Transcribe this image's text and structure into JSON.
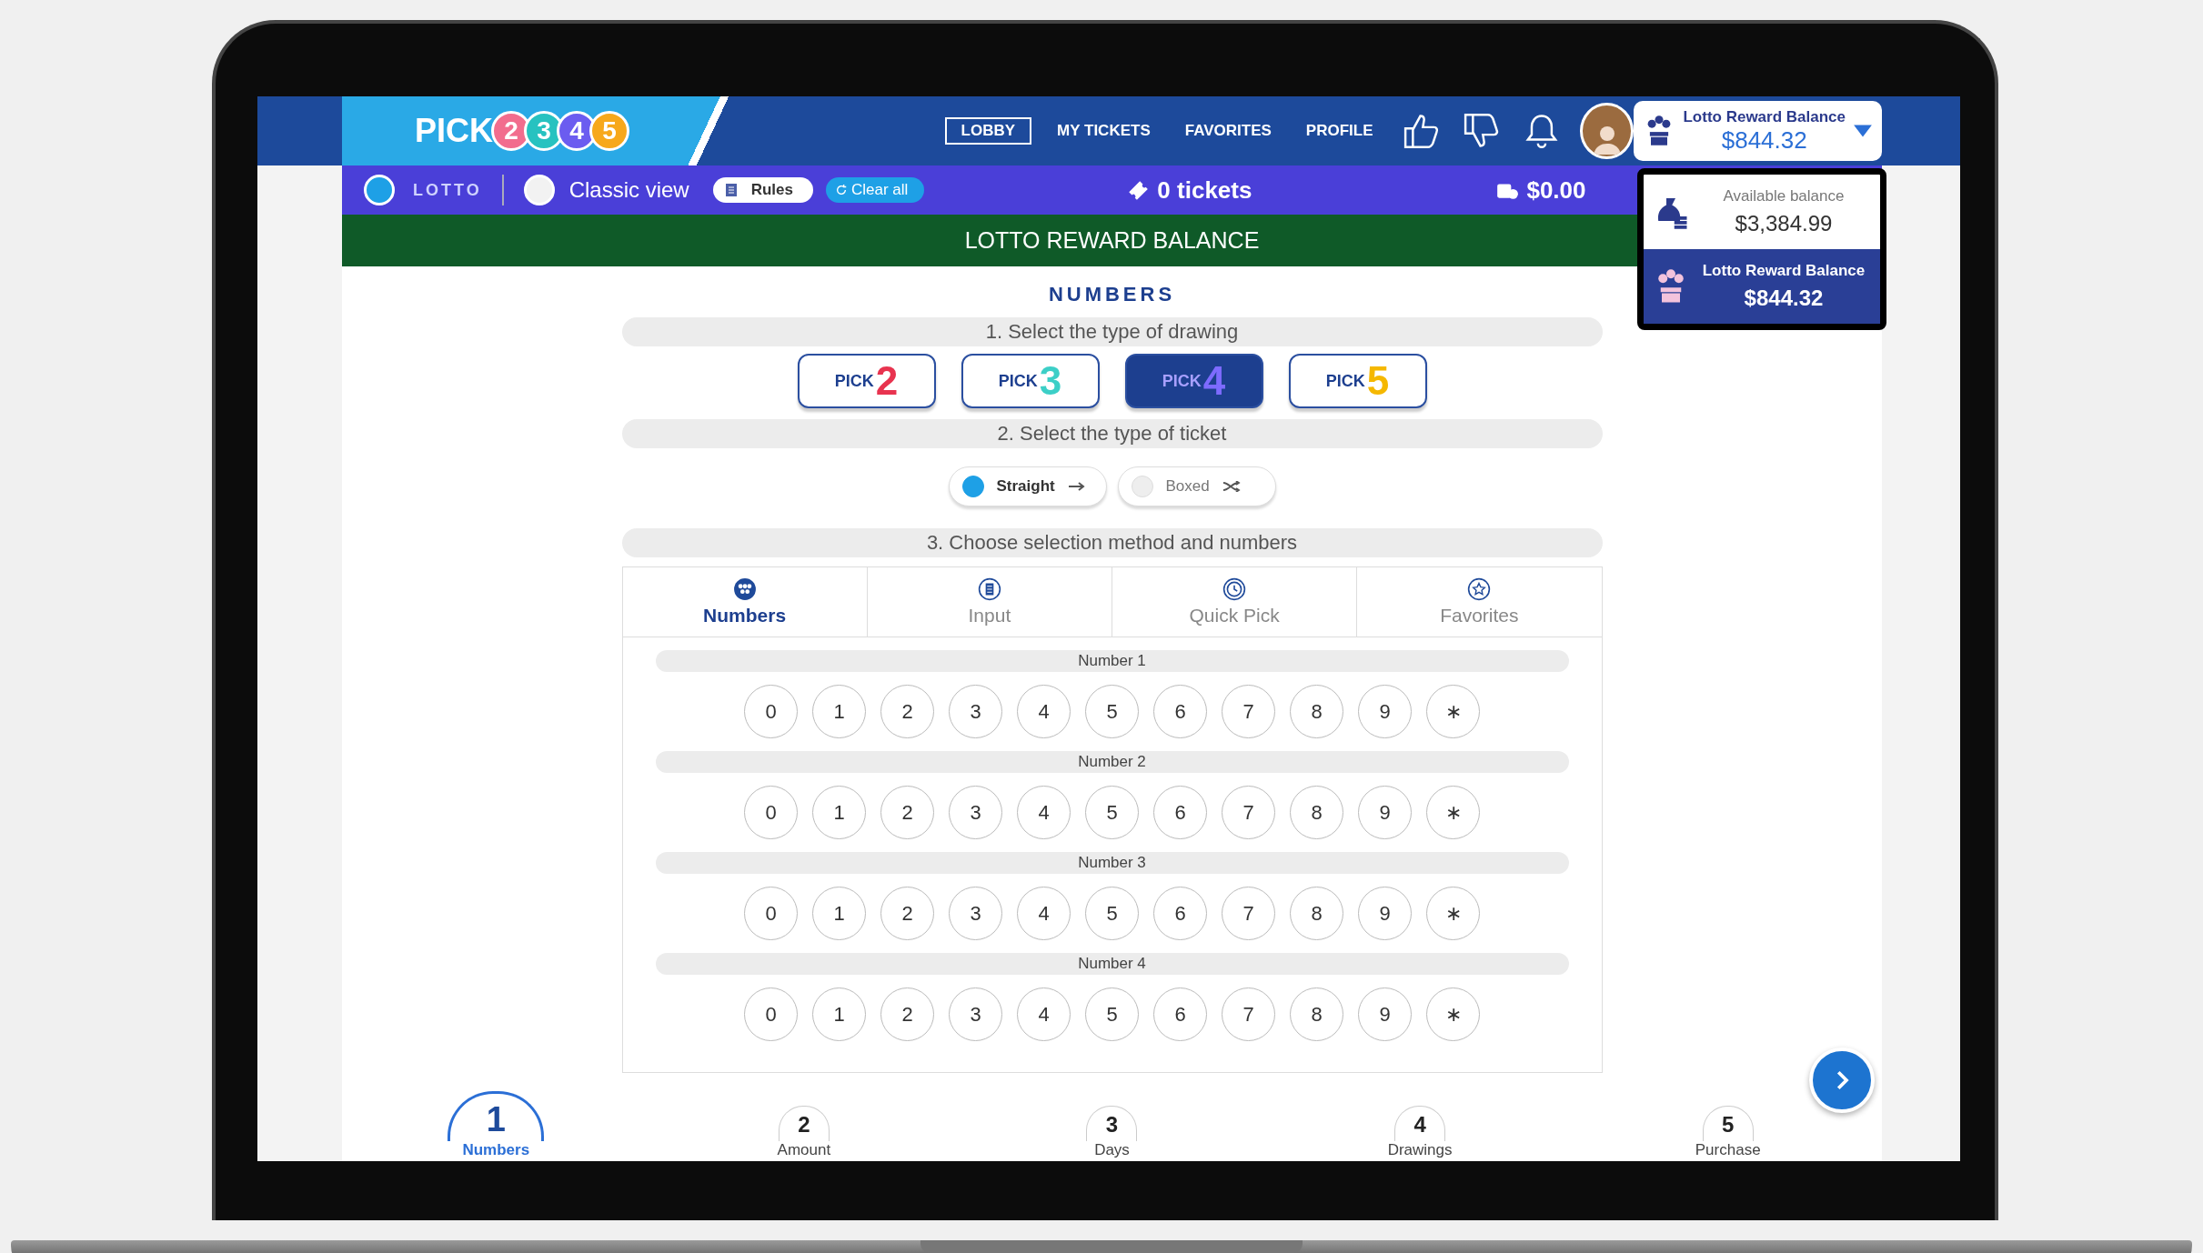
{
  "app_bar": {
    "logo": {
      "word": "PICK",
      "balls": [
        {
          "text": "2",
          "color": "#f26d8e"
        },
        {
          "text": "3",
          "color": "#27c2c0"
        },
        {
          "text": "4",
          "color": "#6b5cf0"
        },
        {
          "text": "5",
          "color": "#f7a81b"
        }
      ]
    },
    "nav": [
      {
        "label": "LOBBY",
        "selected": true
      },
      {
        "label": "MY TICKETS",
        "selected": false
      },
      {
        "label": "FAVORITES",
        "selected": false
      },
      {
        "label": "PROFILE",
        "selected": false
      }
    ],
    "balance": {
      "label": "Lotto Reward Balance",
      "amount": "$844.32",
      "expanded": true
    }
  },
  "balance_menu": [
    {
      "kind": "available",
      "label": "Available balance",
      "amount": "$3,384.99",
      "selected": false
    },
    {
      "kind": "reward",
      "label": "Lotto Reward Balance",
      "amount": "$844.32",
      "selected": true
    }
  ],
  "toolbar": {
    "lotto_toggle": {
      "on": true
    },
    "lotto_logo": "LOTTO",
    "classic_view": {
      "label": "Classic view",
      "on": false
    },
    "rules": "Rules",
    "clear_all": "Clear all",
    "tickets": "0 tickets",
    "total": "$0.00"
  },
  "banner": "LOTTO REWARD BALANCE",
  "section_title": "NUMBERS",
  "drawing_step": {
    "title": "1. Select the type of drawing",
    "options": [
      {
        "word": "PICK",
        "digit": "2",
        "color": "#e8334f",
        "selected": false
      },
      {
        "word": "PICK",
        "digit": "3",
        "color": "#3ccfc7",
        "selected": false
      },
      {
        "word": "PICK",
        "digit": "4",
        "color": "#7d6bff",
        "selected": true
      },
      {
        "word": "PICK",
        "digit": "5",
        "color": "#f5b800",
        "selected": false
      }
    ]
  },
  "ticket_step": {
    "title": "2. Select the type of ticket",
    "options": [
      {
        "kind": "straight",
        "label": "Straight",
        "selected": true
      },
      {
        "kind": "boxed",
        "label": "Boxed",
        "selected": false
      }
    ]
  },
  "method_step": {
    "title": "3. Choose selection method and numbers",
    "tabs": [
      {
        "kind": "numbers",
        "label": "Numbers",
        "selected": true
      },
      {
        "kind": "input",
        "label": "Input",
        "selected": false
      },
      {
        "kind": "quick",
        "label": "Quick Pick",
        "selected": false
      },
      {
        "kind": "favorites",
        "label": "Favorites",
        "selected": false
      }
    ],
    "rows": [
      {
        "label": "Number 1",
        "digits": [
          "0",
          "1",
          "2",
          "3",
          "4",
          "5",
          "6",
          "7",
          "8",
          "9",
          "∗"
        ]
      },
      {
        "label": "Number 2",
        "digits": [
          "0",
          "1",
          "2",
          "3",
          "4",
          "5",
          "6",
          "7",
          "8",
          "9",
          "∗"
        ]
      },
      {
        "label": "Number 3",
        "digits": [
          "0",
          "1",
          "2",
          "3",
          "4",
          "5",
          "6",
          "7",
          "8",
          "9",
          "∗"
        ]
      },
      {
        "label": "Number 4",
        "digits": [
          "0",
          "1",
          "2",
          "3",
          "4",
          "5",
          "6",
          "7",
          "8",
          "9",
          "∗"
        ]
      }
    ]
  },
  "progress_steps": [
    {
      "number": "1",
      "label": "Numbers",
      "selected": true
    },
    {
      "number": "2",
      "label": "Amount",
      "selected": false
    },
    {
      "number": "3",
      "label": "Days",
      "selected": false
    },
    {
      "number": "4",
      "label": "Drawings",
      "selected": false
    },
    {
      "number": "5",
      "label": "Purchase",
      "selected": false
    }
  ]
}
